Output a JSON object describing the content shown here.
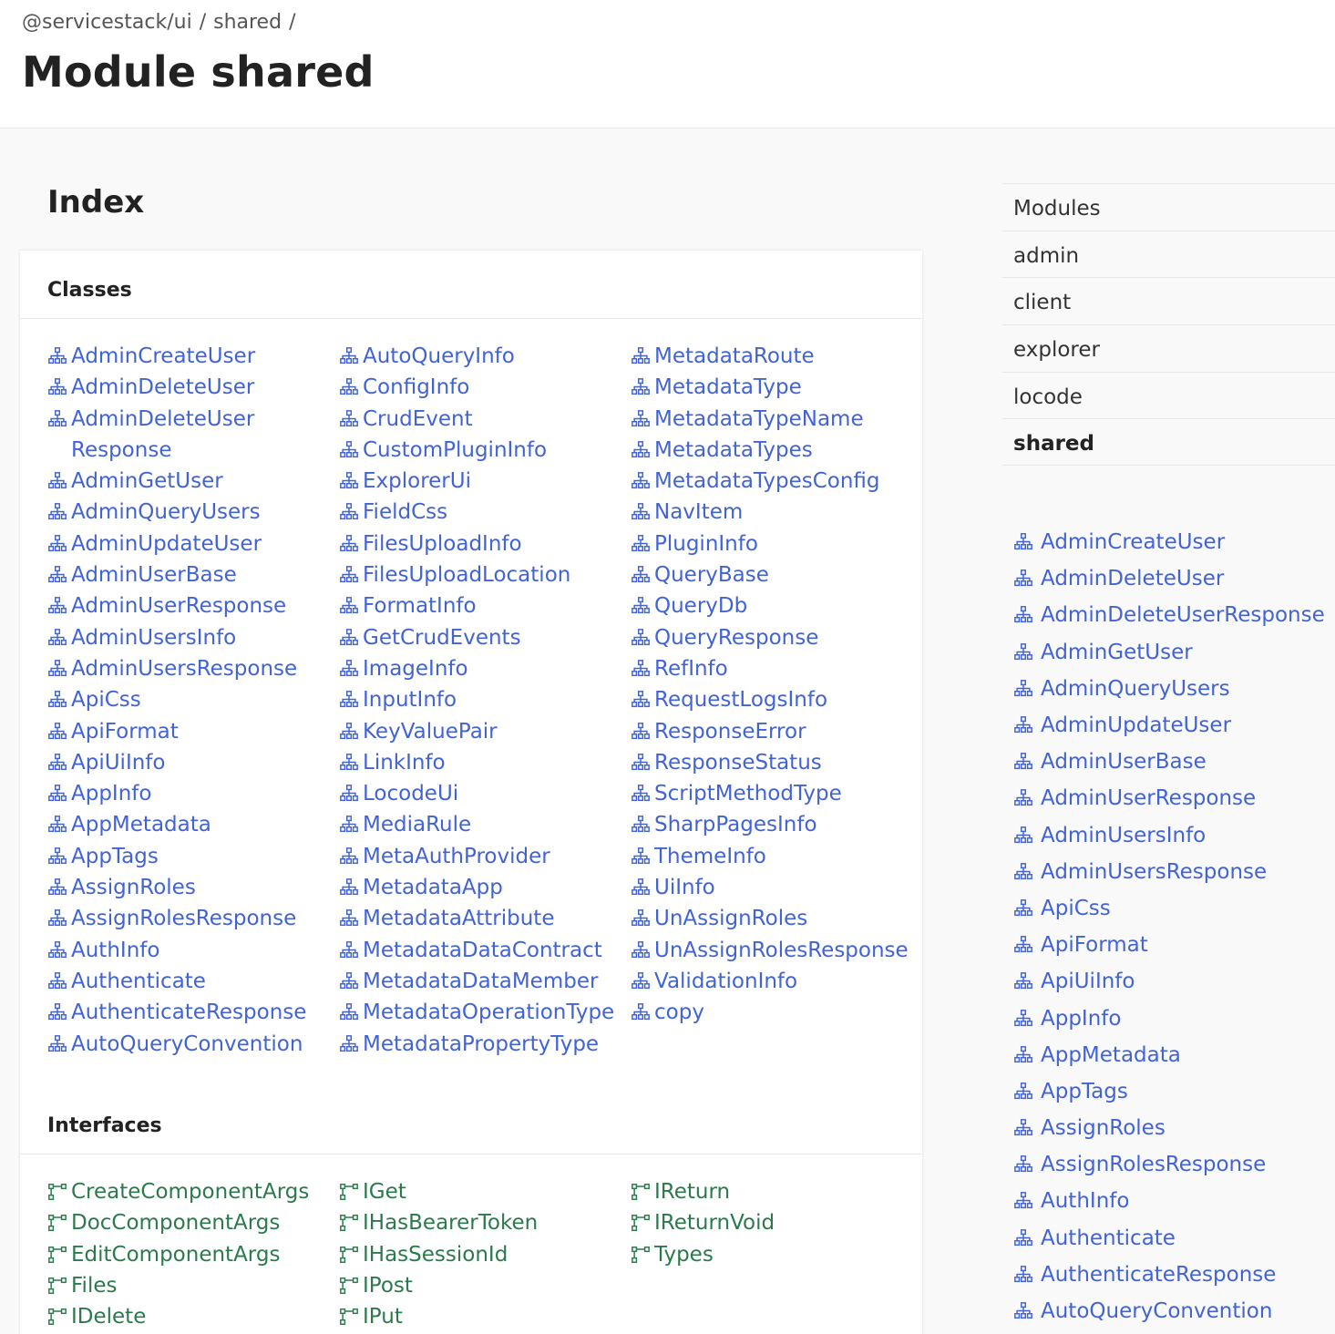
{
  "breadcrumb": [
    "@servicestack/ui",
    "shared"
  ],
  "title": "Module shared",
  "index_title": "Index",
  "sections": {
    "classes_title": "Classes",
    "interfaces_title": "Interfaces"
  },
  "colors": {
    "class_link": "#4263d6",
    "interface_link": "#2b7a4c"
  },
  "icons": {
    "class": "class-icon",
    "interface": "interface-icon"
  },
  "classes": [
    [
      "AdminCreateUser",
      "AdminDeleteUser",
      "AdminDeleteUser Response",
      "AdminGetUser",
      "AdminQueryUsers",
      "AdminUpdateUser",
      "AdminUserBase",
      "AdminUserResponse",
      "AdminUsersInfo",
      "AdminUsersResponse",
      "ApiCss",
      "ApiFormat",
      "ApiUiInfo",
      "AppInfo",
      "AppMetadata",
      "AppTags",
      "AssignRoles",
      "AssignRolesResponse",
      "AuthInfo",
      "Authenticate",
      "AuthenticateResponse",
      "AutoQueryConvention"
    ],
    [
      "AutoQueryInfo",
      "ConfigInfo",
      "CrudEvent",
      "CustomPluginInfo",
      "ExplorerUi",
      "FieldCss",
      "FilesUploadInfo",
      "FilesUploadLocation",
      "FormatInfo",
      "GetCrudEvents",
      "ImageInfo",
      "InputInfo",
      "KeyValuePair",
      "LinkInfo",
      "LocodeUi",
      "MediaRule",
      "MetaAuthProvider",
      "MetadataApp",
      "MetadataAttribute",
      "MetadataDataContract",
      "MetadataDataMember",
      "MetadataOperationType",
      "MetadataPropertyType"
    ],
    [
      "MetadataRoute",
      "MetadataType",
      "MetadataTypeName",
      "MetadataTypes",
      "MetadataTypesConfig",
      "NavItem",
      "PluginInfo",
      "QueryBase",
      "QueryDb",
      "QueryResponse",
      "RefInfo",
      "RequestLogsInfo",
      "ResponseError",
      "ResponseStatus",
      "ScriptMethodType",
      "SharpPagesInfo",
      "ThemeInfo",
      "UiInfo",
      "UnAssignRoles",
      "UnAssignRolesResponse",
      "ValidationInfo",
      "copy"
    ]
  ],
  "interfaces": [
    [
      "CreateComponentArgs",
      "DocComponentArgs",
      "EditComponentArgs",
      "Files",
      "IDelete"
    ],
    [
      "IGet",
      "IHasBearerToken",
      "IHasSessionId",
      "IPost",
      "IPut"
    ],
    [
      "IReturn",
      "IReturnVoid",
      "Types"
    ]
  ],
  "modules": [
    {
      "label": "Modules",
      "active": false
    },
    {
      "label": "admin",
      "active": false
    },
    {
      "label": "client",
      "active": false
    },
    {
      "label": "explorer",
      "active": false
    },
    {
      "label": "locode",
      "active": false
    },
    {
      "label": "shared",
      "active": true
    }
  ],
  "sidebar_classes": [
    "AdminCreateUser",
    "AdminDeleteUser",
    "AdminDeleteUserResponse",
    "AdminGetUser",
    "AdminQueryUsers",
    "AdminUpdateUser",
    "AdminUserBase",
    "AdminUserResponse",
    "AdminUsersInfo",
    "AdminUsersResponse",
    "ApiCss",
    "ApiFormat",
    "ApiUiInfo",
    "AppInfo",
    "AppMetadata",
    "AppTags",
    "AssignRoles",
    "AssignRolesResponse",
    "AuthInfo",
    "Authenticate",
    "AuthenticateResponse",
    "AutoQueryConvention"
  ]
}
